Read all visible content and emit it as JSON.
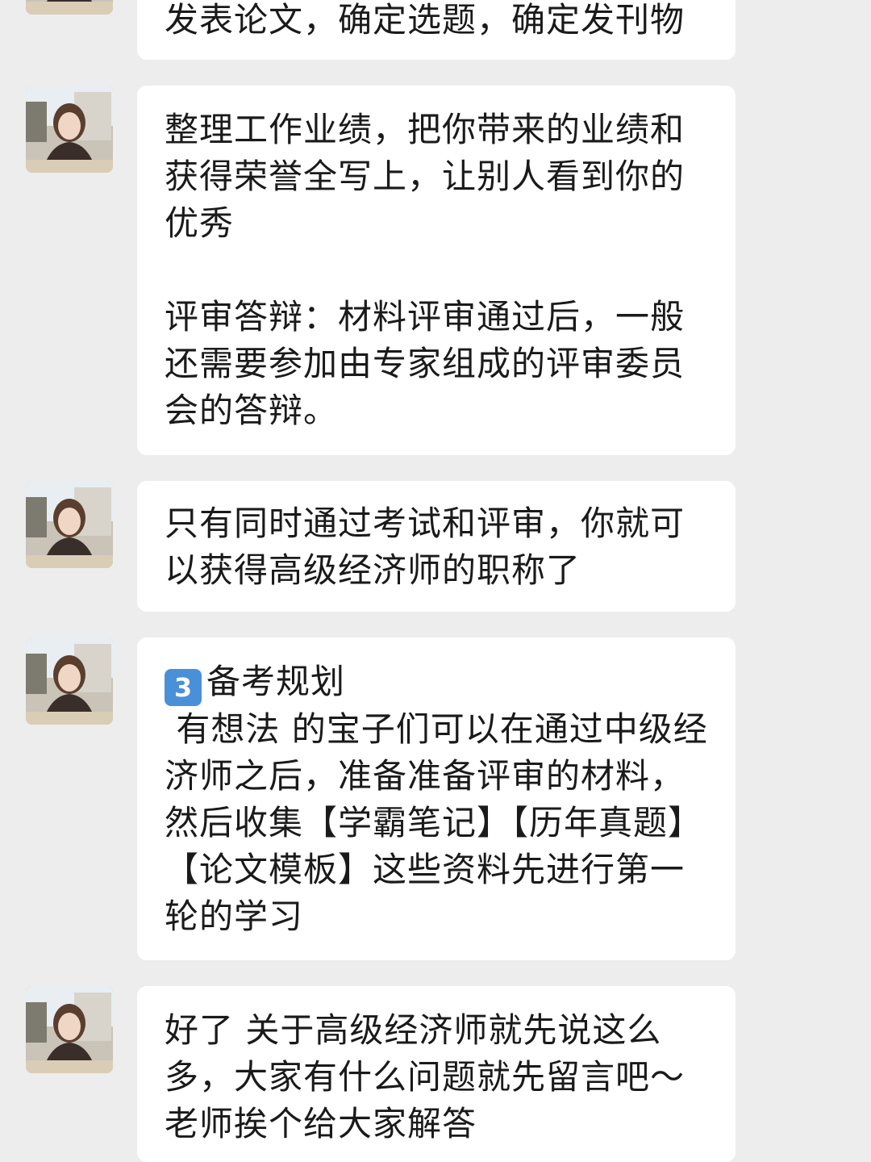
{
  "messages": [
    {
      "sender": "teacher-avatar",
      "text": "发表论文，确定选题，确定发刊物"
    },
    {
      "sender": "teacher-avatar",
      "text_1": "整理工作业绩，把你带来的业绩和获得荣誉全写上，让别人看到你的优秀",
      "text_2": "评审答辩：材料评审通过后，一般还需要参加由专家组成的评审委员会的答辩。"
    },
    {
      "sender": "teacher-avatar",
      "text": "只有同时通过考试和评审，你就可以获得高级经济师的职称了"
    },
    {
      "sender": "teacher-avatar",
      "keycap": "3",
      "heading": "备考规划",
      "text": " 有想法 的宝子们可以在通过中级经济师之后，准备准备评审的材料，然后收集【学霸笔记】【历年真题】【论文模板】这些资料先进行第一轮的学习"
    },
    {
      "sender": "teacher-avatar",
      "text": "好了 关于高级经济师就先说这么多，大家有什么问题就先留言吧～老师挨个给大家解答"
    }
  ],
  "colors": {
    "background": "#ededed",
    "bubble": "#ffffff",
    "text": "#1a1a1a",
    "keycap": "#4a90d9"
  },
  "icons": {
    "avatar": "profile-photo",
    "keycap": "keycap-digit-three-emoji"
  }
}
